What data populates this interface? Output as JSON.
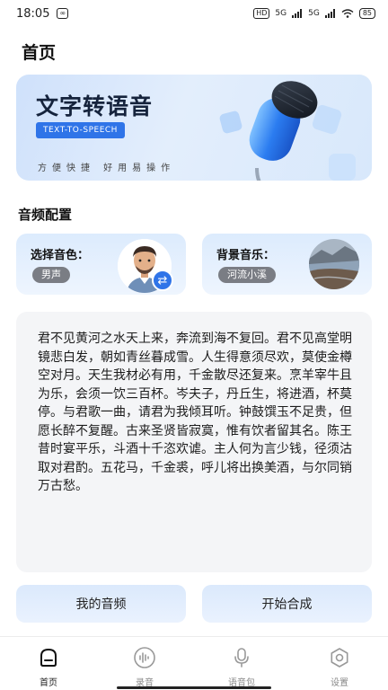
{
  "status_bar": {
    "time": "18:05",
    "left_badge": "∞",
    "hd": "HD",
    "signal1": "5G",
    "signal2": "5G",
    "battery": "85"
  },
  "page": {
    "title": "首页"
  },
  "banner": {
    "title": "文字转语音",
    "tag": "TEXT-TO-SPEECH",
    "subtitle": "方便快捷 好用易操作"
  },
  "audio_config": {
    "section_title": "音频配置",
    "voice": {
      "label": "选择音色：",
      "value": "男声"
    },
    "music": {
      "label": "背景音乐：",
      "value": "河流小溪"
    }
  },
  "text_panel": {
    "content": "君不见黄河之水天上来，奔流到海不复回。君不见高堂明镜悲白发，朝如青丝暮成雪。人生得意须尽欢，莫使金樽空对月。天生我材必有用，千金散尽还复来。烹羊宰牛且为乐，会须一饮三百杯。岑夫子，丹丘生，将进酒，杯莫停。与君歌一曲，请君为我倾耳听。钟鼓馔玉不足贵，但愿长醉不复醒。古来圣贤皆寂寞，惟有饮者留其名。陈王昔时宴平乐，斗酒十千恣欢谑。主人何为言少钱，径须沽取对君酌。五花马，千金裘，呼儿将出换美酒，与尔同销万古愁。"
  },
  "actions": {
    "my_audio": "我的音频",
    "start": "开始合成"
  },
  "tabs": [
    {
      "label": "首页",
      "icon": "home-icon",
      "active": true
    },
    {
      "label": "录音",
      "icon": "waveform-icon",
      "active": false
    },
    {
      "label": "语音包",
      "icon": "microphone-icon",
      "active": false
    },
    {
      "label": "设置",
      "icon": "gear-icon",
      "active": false
    }
  ],
  "colors": {
    "accent": "#2f74e8",
    "chip": "#7a7d84",
    "panel": "#f4f5f7"
  }
}
